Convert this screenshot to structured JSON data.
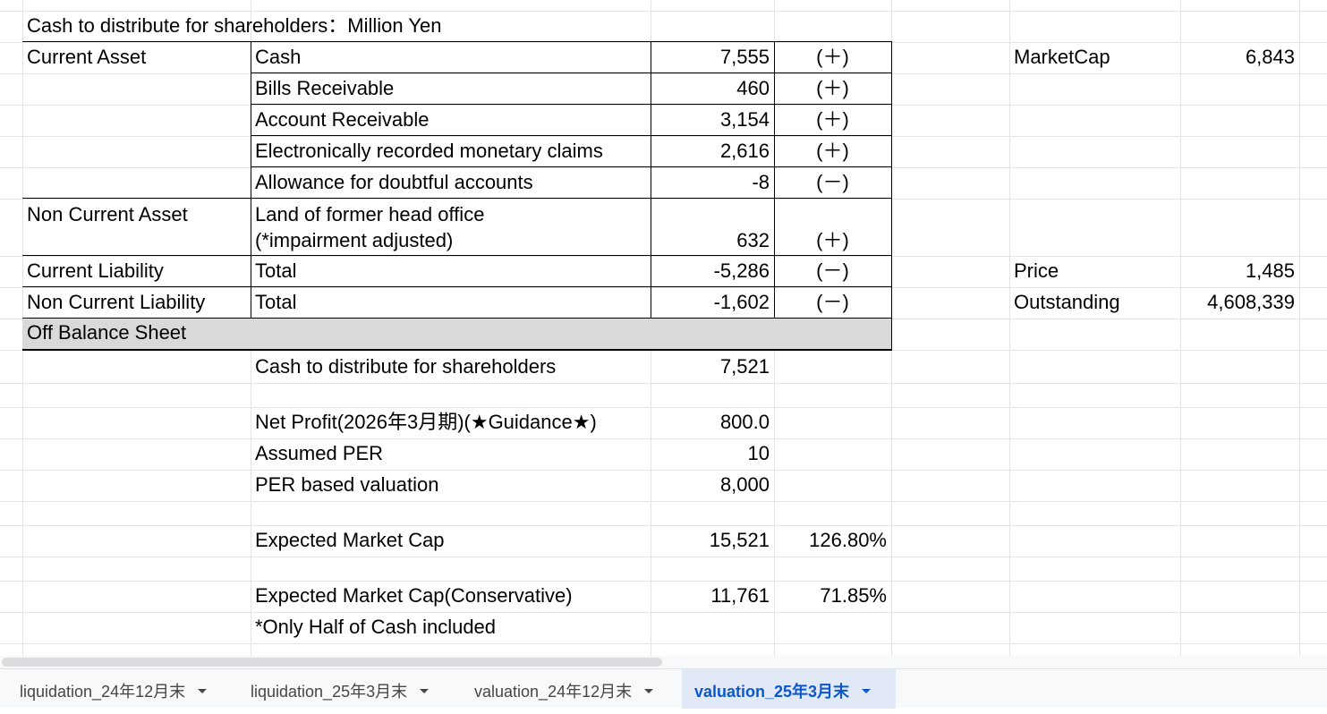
{
  "sheet": {
    "title": "Cash to distribute for shareholders：Million Yen",
    "rows": [
      {
        "category": "Current Asset",
        "item": "Cash",
        "value": "7,555",
        "sign": "(＋)"
      },
      {
        "category": "",
        "item": "Bills Receivable",
        "value": "460",
        "sign": "(＋)"
      },
      {
        "category": "",
        "item": "Account Receivable",
        "value": "3,154",
        "sign": "(＋)"
      },
      {
        "category": "",
        "item": "Electronically recorded monetary claims",
        "value": "2,616",
        "sign": "(＋)"
      },
      {
        "category": "",
        "item": "Allowance for doubtful accounts",
        "value": "-8",
        "sign": "(－)"
      },
      {
        "category": "Non Current Asset",
        "item": "Land of former head office",
        "item_line2": "(*impairment adjusted)",
        "value": "632",
        "sign": "(＋)"
      },
      {
        "category": "Current Liability",
        "item": "Total",
        "value": "-5,286",
        "sign": "(－)"
      },
      {
        "category": "Non Current Liability",
        "item": "Total",
        "value": "-1,602",
        "sign": "(－)"
      },
      {
        "category": "Off Balance Sheet",
        "item": "",
        "value": "",
        "sign": ""
      }
    ],
    "summary": {
      "cash_label": "Cash to distribute for shareholders",
      "cash_value": "7,521",
      "net_profit_label": "Net Profit(2026年3月期)(★Guidance★)",
      "net_profit_value": "800.0",
      "per_label": "Assumed PER",
      "per_value": "10",
      "per_valuation_label": "PER based valuation",
      "per_valuation_value": "8,000",
      "expected_label": "Expected Market Cap",
      "expected_value": "15,521",
      "expected_pct": "126.80%",
      "conservative_label": "Expected Market Cap(Conservative)",
      "conservative_value": "11,761",
      "conservative_pct": "71.85%",
      "note": "*Only Half of Cash included"
    },
    "market": {
      "marketcap_label": "MarketCap",
      "marketcap_value": "6,843",
      "price_label": "Price",
      "price_value": "1,485",
      "outstanding_label": "Outstanding",
      "outstanding_value": "4,608,339"
    }
  },
  "tabs": [
    {
      "label": "liquidation_24年12月末",
      "active": false
    },
    {
      "label": "liquidation_25年3月末",
      "active": false
    },
    {
      "label": "valuation_24年12月末",
      "active": false
    },
    {
      "label": "valuation_25年3月末",
      "active": true
    }
  ]
}
